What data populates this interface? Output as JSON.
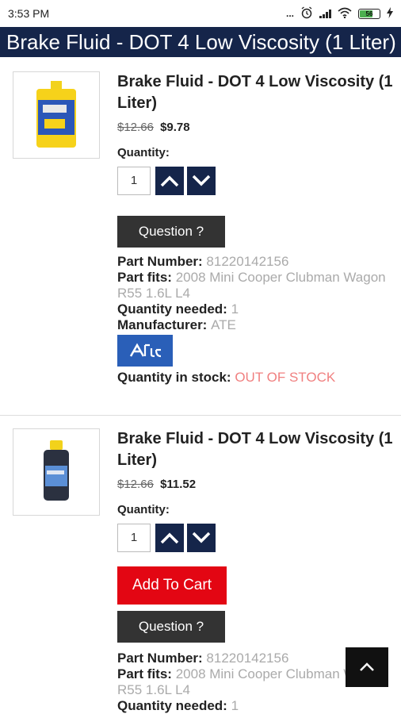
{
  "status_bar": {
    "time": "3:53 PM",
    "dots": "...",
    "battery": "56",
    "icons": [
      "alarm-icon",
      "signal-icon",
      "wifi-icon",
      "battery-icon",
      "charging-icon"
    ]
  },
  "header": {
    "title": "Brake Fluid - DOT 4 Low Viscosity (1 Liter)"
  },
  "products": [
    {
      "name": "Brake Fluid - DOT 4 Low Viscosity (1 Liter)",
      "old_price": "$12.66",
      "price": "$9.78",
      "quantity_label": "Quantity:",
      "quantity_value": "1",
      "question_label": "Question ?",
      "part_number_label": "Part Number:",
      "part_number": "81220142156",
      "part_fits_label": "Part fits:",
      "part_fits": "2008 Mini Cooper Clubman Wagon R55 1.6L L4",
      "quantity_needed_label": "Quantity needed:",
      "quantity_needed": "1",
      "manufacturer_label": "Manufacturer:",
      "manufacturer": "ATE",
      "stock_label": "Quantity in stock:",
      "stock": "OUT OF STOCK"
    },
    {
      "name": "Brake Fluid - DOT 4 Low Viscosity (1 Liter)",
      "old_price": "$12.66",
      "price": "$11.52",
      "quantity_label": "Quantity:",
      "quantity_value": "1",
      "add_to_cart_label": "Add To Cart",
      "question_label": "Question ?",
      "part_number_label": "Part Number:",
      "part_number": "81220142156",
      "part_fits_label": "Part fits:",
      "part_fits": "2008 Mini Cooper Clubman Wagon R55 1.6L L4",
      "quantity_needed_label": "Quantity needed:",
      "quantity_needed": "1"
    }
  ],
  "colors": {
    "header_bg": "#15254a",
    "add_to_cart": "#e30613",
    "out_of_stock": "#f08080"
  }
}
